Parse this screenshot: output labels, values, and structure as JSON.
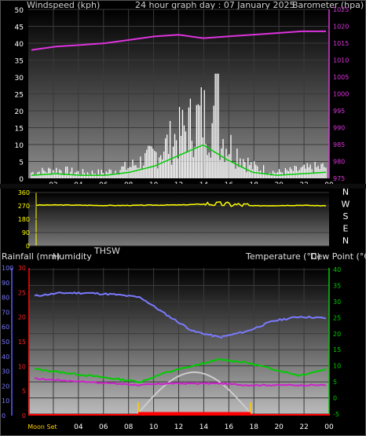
{
  "header": {
    "left_label": "Windspeed (kph)",
    "title": "24 hour graph day : 07 January 2025",
    "right_label": "Barometer (hpa)"
  },
  "wind_panel": {
    "y_ticks": [
      "0",
      "5",
      "10",
      "15",
      "20",
      "25",
      "30",
      "35",
      "40",
      "45",
      "50"
    ],
    "baro_ticks": [
      "975",
      "980",
      "985",
      "990",
      "995",
      "1000",
      "1005",
      "1010",
      "1015",
      "1020",
      "1025"
    ],
    "x_ticks": [
      "02",
      "04",
      "06",
      "08",
      "10",
      "12",
      "14",
      "16",
      "18",
      "20",
      "22",
      "00"
    ]
  },
  "dir_panel": {
    "y_ticks": [
      "0",
      "90",
      "180",
      "270",
      "360"
    ],
    "compass": [
      "N",
      "W",
      "S",
      "E",
      "N"
    ]
  },
  "temp_header": {
    "rainfall_label": "Rainfall (mm)",
    "humidity_label": "Humidity",
    "thsw_label": "THSW",
    "temp_label": "Temperature (°C)",
    "dew_label": "Dew Point (°C)"
  },
  "temp_panel": {
    "humidity_ticks": [
      "0",
      "10",
      "20",
      "30",
      "40",
      "50",
      "60",
      "70",
      "80",
      "90",
      "100"
    ],
    "rain_ticks": [
      "0",
      "5",
      "10",
      "15",
      "20",
      "25",
      "30"
    ],
    "temp_ticks": [
      "-5",
      "0",
      "5",
      "10",
      "15",
      "20",
      "25",
      "30",
      "35",
      "40"
    ],
    "x_ticks": [
      "Moon Set",
      "04",
      "06",
      "08",
      "10",
      "12",
      "14",
      "16",
      "18",
      "20",
      "22",
      "00"
    ]
  },
  "colors": {
    "wind_gust": "#ffffff",
    "wind_avg": "#00cc00",
    "barometer": "#dd33dd",
    "direction": "#ffff00",
    "humidity": "#7a7aff",
    "temperature": "#00cc00",
    "dew_point": "#cc22cc",
    "rain_axis": "#ff0000",
    "sun": "#cccccc",
    "sun_marker": "#ffcc00"
  },
  "chart_data": [
    {
      "type": "line",
      "xlabel": "",
      "ylabel": "Windspeed (kph)",
      "x": [
        "00",
        "02",
        "04",
        "06",
        "08",
        "10",
        "12",
        "14",
        "16",
        "18",
        "20",
        "22",
        "00"
      ],
      "ylim": [
        0,
        50
      ],
      "series": [
        {
          "name": "Windspeed (kph)",
          "values": [
            2,
            3,
            2,
            2,
            4,
            8,
            15,
            22,
            12,
            4,
            2,
            3,
            4
          ]
        },
        {
          "name": "Barometer (hpa)",
          "values": [
            1013,
            1014,
            1014.5,
            1015,
            1016,
            1017,
            1017.5,
            1016.5,
            1017,
            1017.5,
            1018,
            1018.5,
            1018.5
          ]
        }
      ],
      "y2lim": [
        975,
        1025
      ]
    },
    {
      "type": "line",
      "ylabel": "Wind direction",
      "ylim": [
        0,
        360
      ],
      "series": [
        {
          "name": "Direction",
          "values": [
            275,
            276,
            274,
            272,
            273,
            275,
            276,
            282,
            276,
            270,
            272,
            274,
            270
          ]
        }
      ]
    },
    {
      "type": "line",
      "x": [
        "02",
        "04",
        "06",
        "08",
        "10",
        "12",
        "14",
        "16",
        "18",
        "20",
        "22",
        "00"
      ],
      "series": [
        {
          "name": "Humidity",
          "values": [
            81,
            83,
            83,
            82,
            80,
            68,
            57,
            53,
            57,
            64,
            67,
            66
          ]
        },
        {
          "name": "Temperature (°C)",
          "values": [
            9,
            8,
            7,
            6,
            5,
            8,
            10,
            12,
            11,
            9,
            7,
            9
          ]
        },
        {
          "name": "Dew Point (°C)",
          "values": [
            6,
            5.5,
            5,
            4.5,
            4,
            4.5,
            4.5,
            4.5,
            4,
            4,
            4,
            4
          ]
        },
        {
          "name": "THSW",
          "values": [
            0,
            0,
            0,
            0,
            2,
            6,
            8,
            6,
            0,
            0,
            0,
            0
          ]
        }
      ],
      "humidity_lim": [
        0,
        100
      ],
      "rain_lim": [
        0,
        30
      ],
      "temp_lim": [
        -5,
        40
      ]
    }
  ]
}
